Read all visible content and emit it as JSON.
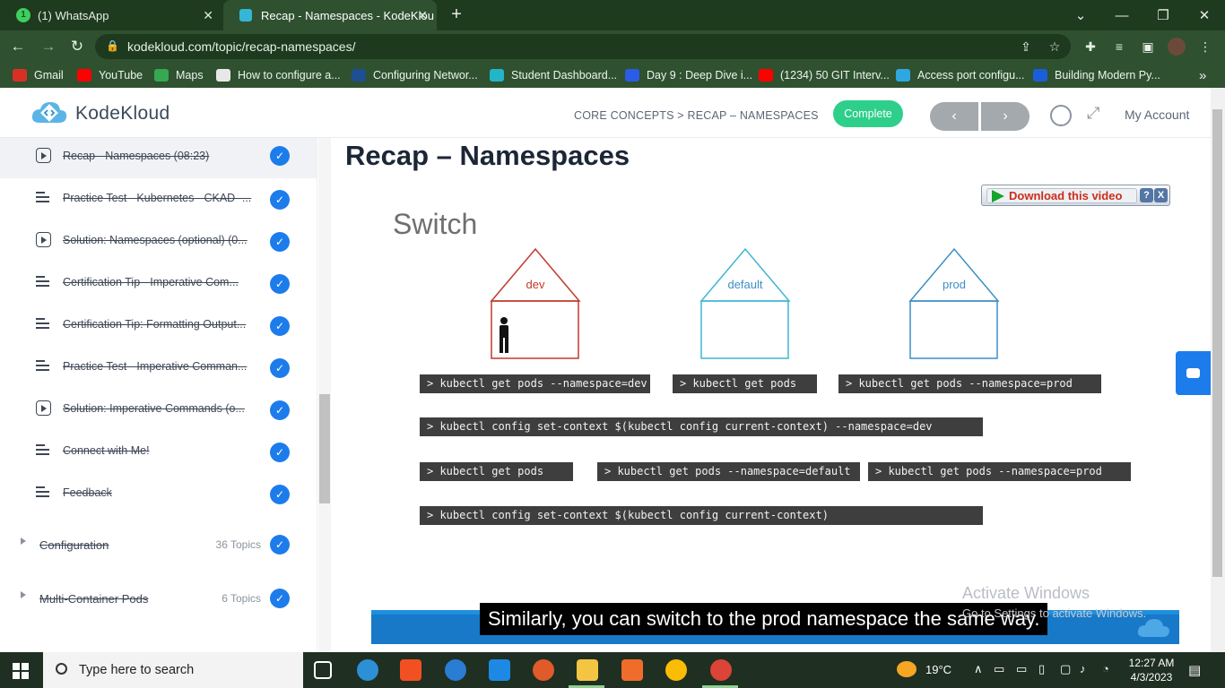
{
  "browser": {
    "tabs": [
      {
        "title": "(1) WhatsApp",
        "badge": "1"
      },
      {
        "title": "Recap - Namespaces - KodeKlou",
        "active": true
      }
    ],
    "new_tab": "+",
    "close": "✕",
    "url": "kodekloud.com/topic/recap-namespaces/",
    "bookmarks": [
      {
        "label": "Gmail",
        "color": "#d93025"
      },
      {
        "label": "YouTube",
        "color": "#ff0000"
      },
      {
        "label": "Maps",
        "color": "#34a853"
      },
      {
        "label": "How to configure a...",
        "color": "#e8e8e8"
      },
      {
        "label": "Configuring Networ...",
        "color": "#1d4f91"
      },
      {
        "label": "Student Dashboard...",
        "color": "#23b5c8"
      },
      {
        "label": "Day 9 : Deep Dive i...",
        "color": "#2a5ce6"
      },
      {
        "label": "(1234) 50 GIT Interv...",
        "color": "#ff0000"
      },
      {
        "label": "Access port configu...",
        "color": "#2fa7e0"
      },
      {
        "label": "Building Modern Py...",
        "color": "#1a5fd8"
      }
    ],
    "more_bookmarks": "»"
  },
  "site": {
    "logo_text": "KodeKloud",
    "breadcrumb": "CORE CONCEPTS > RECAP – NAMESPACES",
    "complete_label": "Complete",
    "prev_label": "‹",
    "next_label": "›",
    "account_label": "My Account"
  },
  "sidebar": {
    "lessons": [
      {
        "icon": "play",
        "title": "Recap - Namespaces (08:23)",
        "current": true
      },
      {
        "icon": "doc",
        "title": "Practice Test - Kubernetes - CKAD -..."
      },
      {
        "icon": "play",
        "title": "Solution: Namespaces (optional) (0..."
      },
      {
        "icon": "doc",
        "title": "Certification Tip - Imperative Com..."
      },
      {
        "icon": "doc",
        "title": "Certification Tip: Formatting Output..."
      },
      {
        "icon": "doc",
        "title": "Practice Test - Imperative Comman..."
      },
      {
        "icon": "play",
        "title": "Solution: Imperative Commands (o..."
      },
      {
        "icon": "doc",
        "title": "Connect with Me!"
      },
      {
        "icon": "doc",
        "title": "Feedback"
      }
    ],
    "sections": [
      {
        "title": "Configuration",
        "count": "36 Topics"
      },
      {
        "title": "Multi-Container Pods",
        "count": "6 Topics"
      }
    ],
    "check_glyph": "✓"
  },
  "main": {
    "title": "Recap – Namespaces",
    "download": {
      "label": "Download this video",
      "help": "?",
      "close": "X"
    },
    "slide": {
      "heading": "Switch",
      "houses": [
        {
          "label": "dev",
          "color": "#c0392b"
        },
        {
          "label": "default",
          "color": "#3fb6d4"
        },
        {
          "label": "prod",
          "color": "#3e8ec4"
        }
      ],
      "commands": {
        "row1": [
          "> kubectl get pods --namespace=dev",
          "> kubectl get pods",
          "> kubectl get pods --namespace=prod"
        ],
        "row2": "> kubectl config set-context $(kubectl config current-context) --namespace=dev",
        "row3": [
          "> kubectl get pods",
          "> kubectl get pods --namespace=default",
          "> kubectl get pods --namespace=prod"
        ],
        "row4": "> kubectl config set-context $(kubectl config current-context)"
      }
    },
    "caption": "Similarly, you can switch to the prod namespace the same way.",
    "watermark_title": "Activate Windows",
    "watermark_sub": "Go to Settings to activate Windows."
  },
  "taskbar": {
    "search_placeholder": "Type here to search",
    "weather": "19°C",
    "time": "12:27 AM",
    "date": "4/3/2023"
  }
}
